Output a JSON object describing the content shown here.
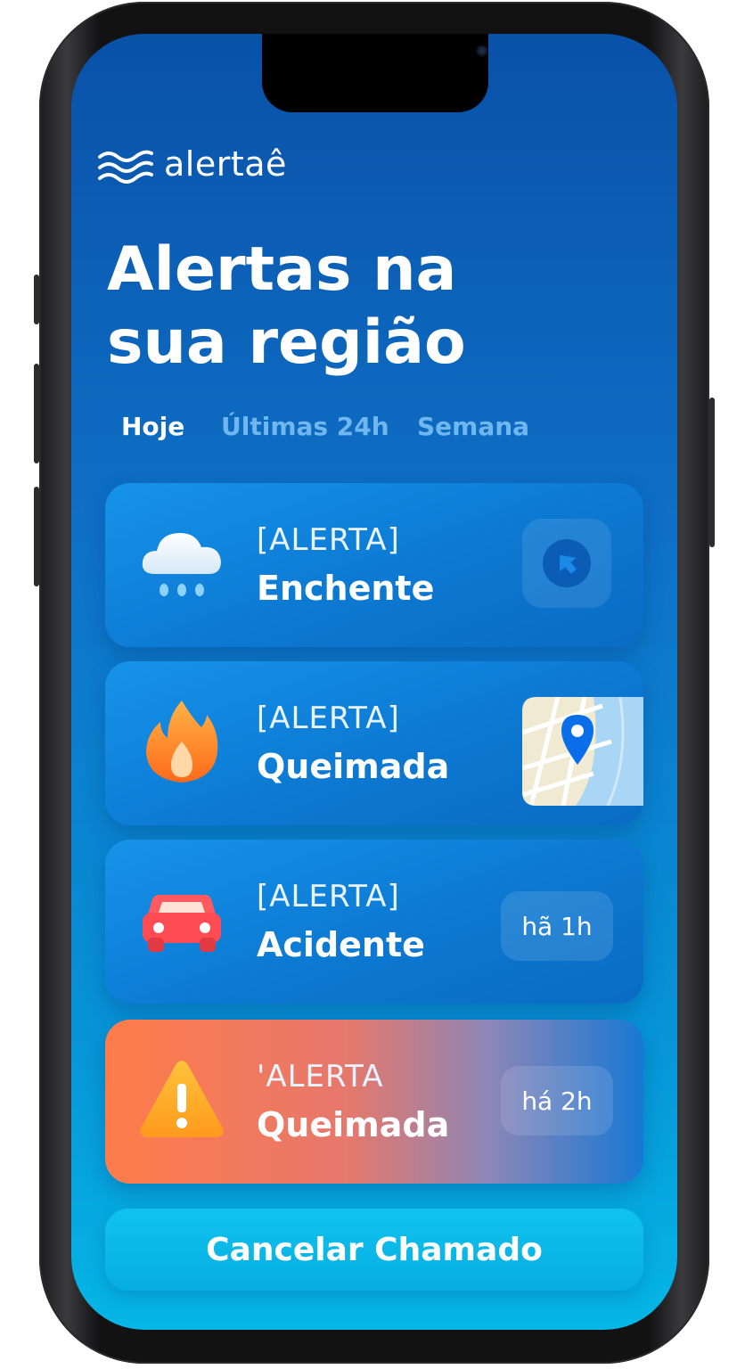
{
  "app": {
    "logo_text": "alertaê"
  },
  "header": {
    "title_line1": "Alertas na",
    "title_line2": "sua região"
  },
  "tabs": [
    {
      "label": "Hoje",
      "active": true
    },
    {
      "label": "Últimas 24h",
      "active": false
    },
    {
      "label": "Semana",
      "active": false
    }
  ],
  "alerts": [
    {
      "tag": "[ALERTA]",
      "type": "Enchente",
      "icon": "rain-cloud-icon",
      "action": "navigation-icon"
    },
    {
      "tag": "[ALERTA]",
      "type": "Queimada",
      "icon": "fire-icon",
      "action": "map-pin-icon"
    },
    {
      "tag": "[ALERTA]",
      "type": "Acidente",
      "icon": "car-icon",
      "time": "hã 1h"
    },
    {
      "tag": "'ALERTA",
      "type": "Queimada",
      "icon": "warning-icon",
      "time": "há 2h"
    }
  ],
  "footer": {
    "cancel_label": "Cancelar Chamado"
  },
  "colors": {
    "background_top": "#0a51a8",
    "background_bottom": "#05b6e6",
    "card": "#0c79d2",
    "highlight_card": "#ff7c4a",
    "cancel_button": "#10c3ee",
    "inactive_tab": "#6fb7ee"
  }
}
